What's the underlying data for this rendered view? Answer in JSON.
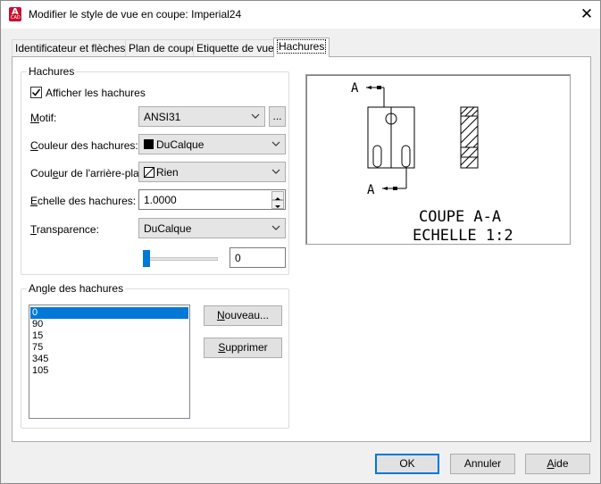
{
  "window": {
    "title": "Modifier le style de vue en coupe: Imperial24"
  },
  "tabs": [
    "Identificateur et flèches",
    "Plan de coupe",
    "Etiquette de vue",
    "Hachures"
  ],
  "hatch_group": {
    "title": "Hachures",
    "show_hatch": {
      "label": "Afficher les hachures",
      "checked": true
    },
    "pattern": {
      "label_u": "M",
      "label_rest": "otif:",
      "value": "ANSI31",
      "browse": "..."
    },
    "hatch_color": {
      "label_u": "C",
      "label_rest": "ouleur des hachures:",
      "value": "DuCalque",
      "swatch": "#000000"
    },
    "bg_color": {
      "label_pre": "Coul",
      "label_u": "e",
      "label_rest": "ur de l'arrière-plan:",
      "value": "Rien"
    },
    "hatch_scale": {
      "label_u": "E",
      "label_rest": "chelle des hachures:",
      "value": "1.0000"
    },
    "transparency": {
      "label_u": "T",
      "label_rest": "ransparence:",
      "value": "DuCalque",
      "input_value": "0",
      "level": 0
    }
  },
  "angle_group": {
    "title": "Angle des hachures",
    "angles": [
      "0",
      "90",
      "15",
      "75",
      "345",
      "105"
    ],
    "selected_index": 0,
    "new_button": {
      "u": "N",
      "rest": "ouveau..."
    },
    "delete_button": {
      "u": "S",
      "rest": "upprimer"
    }
  },
  "preview": {
    "marker": "A",
    "caption_line1": "COUPE A-A",
    "caption_line2": "ECHELLE 1:2"
  },
  "footer": {
    "ok": "OK",
    "cancel": "Annuler",
    "help_u": "A",
    "help_rest": "ide"
  },
  "colors": {
    "accent": "#0078d7",
    "close_icon": "#000000"
  }
}
